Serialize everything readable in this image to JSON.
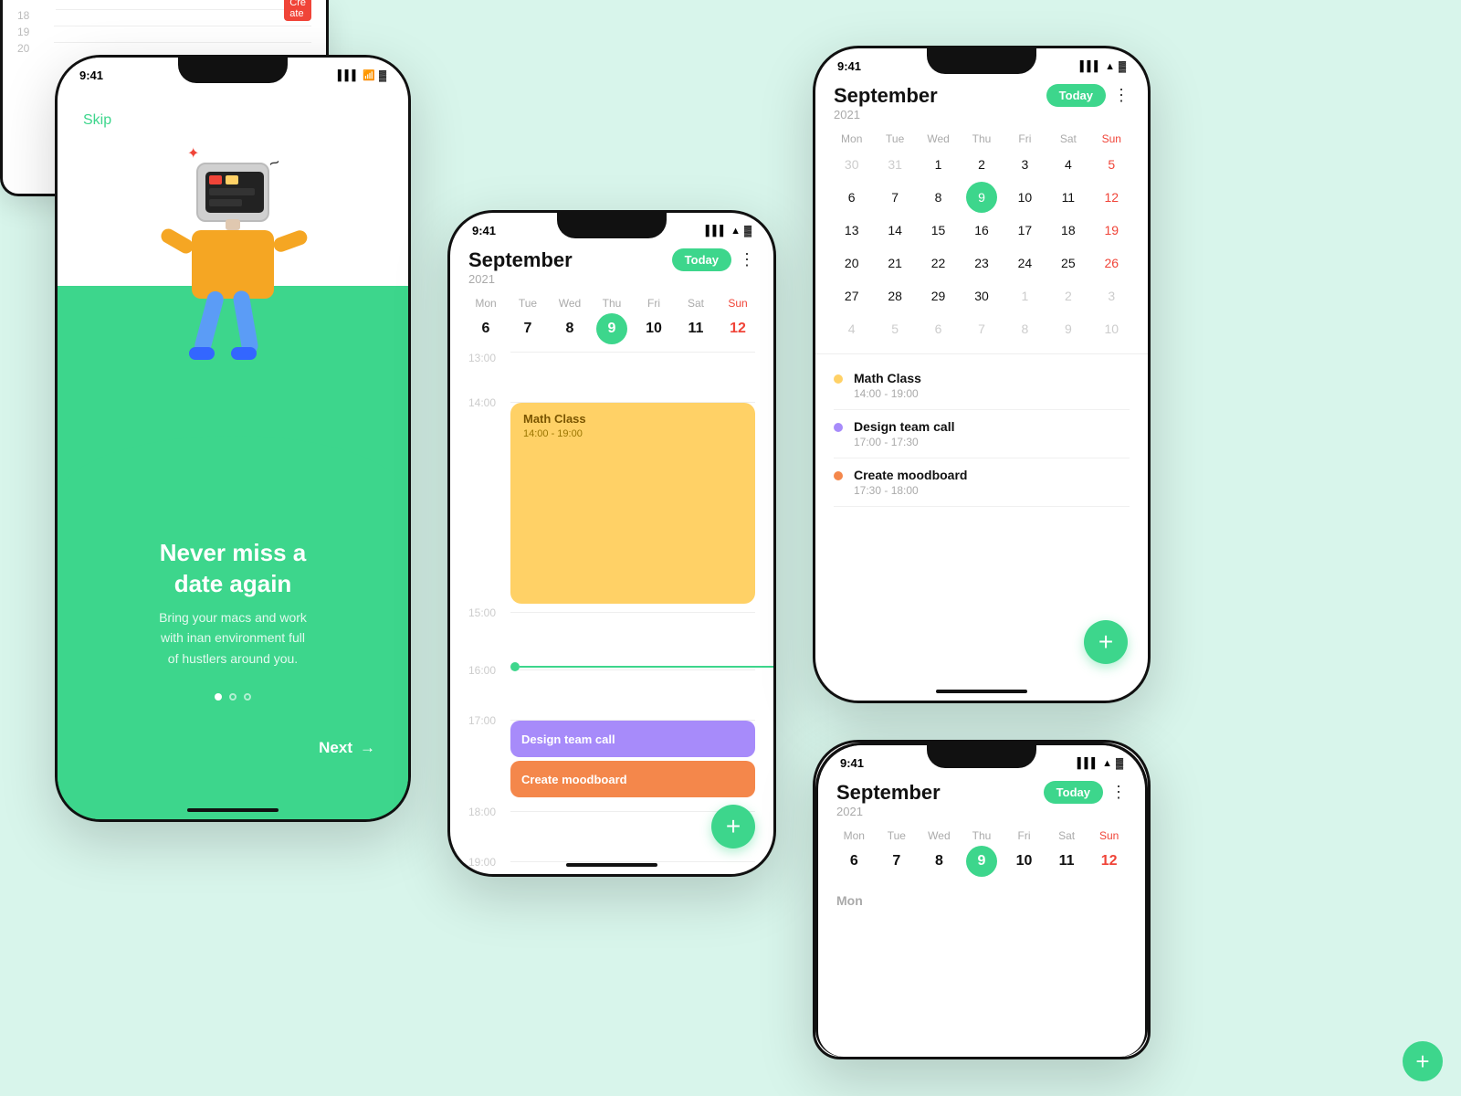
{
  "status_bar": {
    "time": "9:41",
    "signal": "▌▌▌",
    "wifi": "WiFi",
    "battery": "▓▓▓"
  },
  "onboarding": {
    "skip": "Skip",
    "title": "Never miss a\ndate again",
    "subtitle": "Bring your macs and work\nwith inan environment full\nof hustlers around you.",
    "next_label": "Next",
    "dots": [
      "active",
      "outline",
      "outline"
    ]
  },
  "calendar": {
    "month": "September",
    "year": "2021",
    "today_label": "Today",
    "week_days": [
      "Mon",
      "Tue",
      "Wed",
      "Thu",
      "Fri",
      "Sat",
      "Sun"
    ],
    "week_numbers": [
      "6",
      "7",
      "8",
      "9",
      "10",
      "11",
      "12"
    ],
    "cal_rows": [
      [
        "30",
        "31",
        "1",
        "2",
        "3",
        "4",
        "5"
      ],
      [
        "6",
        "7",
        "8",
        "9",
        "10",
        "11",
        "12"
      ],
      [
        "13",
        "14",
        "15",
        "16",
        "17",
        "18",
        "19"
      ],
      [
        "20",
        "21",
        "22",
        "23",
        "24",
        "25",
        "26"
      ],
      [
        "27",
        "28",
        "29",
        "30",
        "1",
        "2",
        "3"
      ],
      [
        "4",
        "5",
        "6",
        "7",
        "8",
        "9",
        "10"
      ]
    ]
  },
  "schedule": {
    "times": [
      "13:00",
      "14:00",
      "15:00",
      "16:00",
      "17:00",
      "18:00",
      "19:00",
      "20:00"
    ],
    "events": [
      {
        "title": "Math Class",
        "time": "14:00 - 19:00",
        "color": "math"
      },
      {
        "title": "Design team call",
        "time": "17:00 - 17:30",
        "color": "design"
      },
      {
        "title": "Create moodboard",
        "time": "17:30 - 18:00",
        "color": "moodboard"
      }
    ],
    "fab_icon": "+"
  },
  "events_list": [
    {
      "title": "Math Class",
      "time": "14:00 - 19:00",
      "dot": "yellow"
    },
    {
      "title": "Design team call",
      "time": "17:00 - 17:30",
      "dot": "purple"
    },
    {
      "title": "Create moodboard",
      "time": "17:30 - 18:00",
      "dot": "orange"
    }
  ],
  "colors": {
    "accent": "#3dd68c",
    "math_event": "#ffd166",
    "design_event": "#a78bfa",
    "moodboard_event": "#f4874b",
    "sunday": "#f04438"
  }
}
